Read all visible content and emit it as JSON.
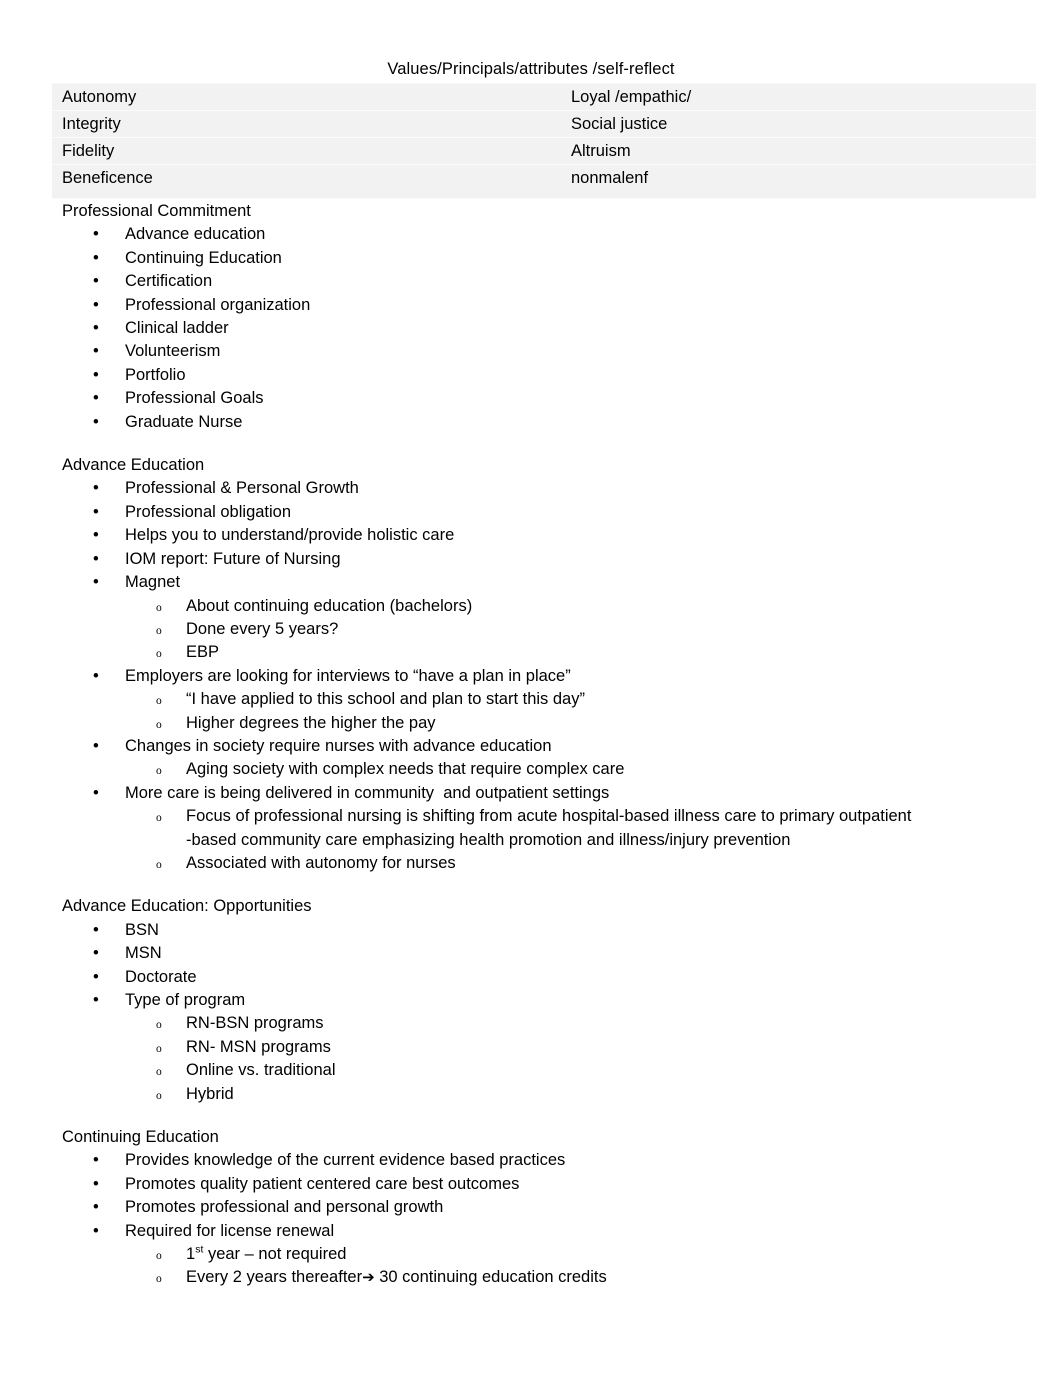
{
  "document": {
    "title": "Values/Principals/attributes /self-reflect"
  },
  "values_table": {
    "rows": [
      {
        "left": "Autonomy",
        "right": "Loyal /empathic/"
      },
      {
        "left": "Integrity",
        "right": "Social justice"
      },
      {
        "left": "Fidelity",
        "right": "Altruism"
      },
      {
        "left": "Beneficence",
        "right": "nonmalenf"
      }
    ]
  },
  "sections": [
    {
      "heading": "Professional Commitment",
      "bullets": [
        {
          "text": "Advance education"
        },
        {
          "text": "Continuing Education"
        },
        {
          "text": "Certification"
        },
        {
          "text": "Professional organization"
        },
        {
          "text": "Clinical ladder"
        },
        {
          "text": "Volunteerism"
        },
        {
          "text": "Portfolio"
        },
        {
          "text": "Professional Goals"
        },
        {
          "text": "Graduate Nurse"
        }
      ]
    },
    {
      "heading": "Advance Education",
      "bullets": [
        {
          "text": "Professional & Personal Growth"
        },
        {
          "text": "Professional obligation"
        },
        {
          "text": "Helps you to understand/provide holistic care"
        },
        {
          "text": "IOM report: Future of Nursing"
        },
        {
          "text": "Magnet",
          "subs": [
            {
              "text": "About continuing education (bachelors)"
            },
            {
              "text": "Done every 5 years?"
            },
            {
              "text": "EBP"
            }
          ]
        },
        {
          "text": "Employers are looking for interviews to “have a plan in place”",
          "subs": [
            {
              "text": "“I have applied to this school and plan to start this day”"
            },
            {
              "text": "Higher degrees the higher the pay"
            }
          ]
        },
        {
          "text": "Changes in society require nurses with advance education",
          "subs": [
            {
              "text": "Aging society with complex needs that require complex care"
            }
          ]
        },
        {
          "text": "More care is being delivered in community  and outpatient settings",
          "subs": [
            {
              "text": "Focus of professional nursing is shifting from acute hospital-based illness care to primary outpatient\n-based community care emphasizing health promotion and illness/injury prevention"
            },
            {
              "text": "Associated with autonomy for nurses"
            }
          ]
        }
      ]
    },
    {
      "heading": "Advance Education: Opportunities",
      "bullets": [
        {
          "text": "BSN"
        },
        {
          "text": "MSN"
        },
        {
          "text": "Doctorate"
        },
        {
          "text": "Type of program",
          "subs": [
            {
              "text": "RN-BSN programs"
            },
            {
              "text": "RN- MSN programs"
            },
            {
              "text": "Online vs. traditional"
            },
            {
              "text": "Hybrid"
            }
          ]
        }
      ]
    },
    {
      "heading": "Continuing Education",
      "bullets": [
        {
          "text": "Provides knowledge of the current evidence based practices"
        },
        {
          "text": "Promotes quality patient centered care best outcomes"
        },
        {
          "text": "Promotes professional and personal growth"
        },
        {
          "text": "Required for license renewal",
          "subs": [
            {
              "text": "1st year – not required",
              "ordinal": {
                "number": "1",
                "suffix": "st",
                "rest": " year – not required"
              }
            },
            {
              "text": "Every 2 years thereafter➔ 30 continuing education credits",
              "arrow": {
                "before": "Every 2 years thereafter",
                "glyph": "➔",
                "after": " 30 continuing education credits"
              }
            }
          ]
        }
      ]
    }
  ],
  "glyphs": {
    "bullet_level1": "•",
    "bullet_level2": "o",
    "arrow": "➔"
  }
}
